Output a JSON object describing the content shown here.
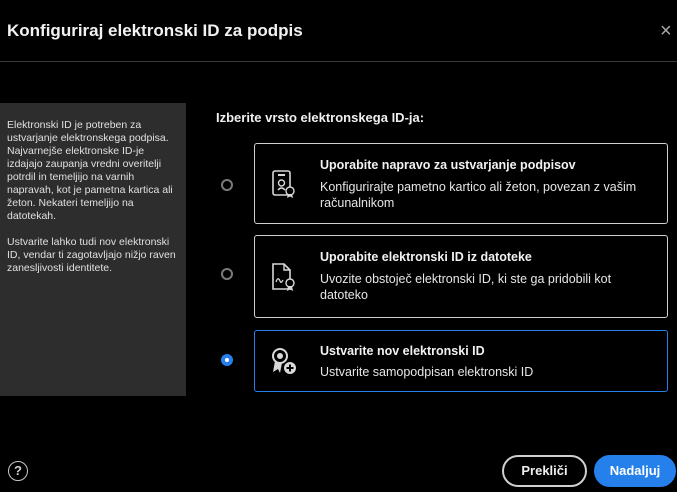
{
  "dialog": {
    "title": "Konfiguriraj elektronski ID za podpis",
    "close_glyph": "×"
  },
  "help_panel": {
    "paragraph_1": "Elektronski ID je potreben za ustvarjanje elektronskega podpisa. Najvarnejše elektronske ID-je izdajajo zaupanja vredni overitelji potrdil in temeljijo na varnih napravah, kot je pametna kartica ali žeton. Nekateri temeljijo na datotekah.",
    "paragraph_2": "Ustvarite lahko tudi nov elektronski ID, vendar ti zagotavljajo nižjo raven zanesljivosti identitete."
  },
  "section_label": "Izberite vrsto elektronskega ID-ja:",
  "options": [
    {
      "title": "Uporabite napravo za ustvarjanje podpisov",
      "description": "Konfigurirajte pametno kartico ali žeton, povezan z vašim računalnikom",
      "icon": "smartcard-device-icon",
      "selected": false
    },
    {
      "title": "Uporabite elektronski ID iz datoteke",
      "description": "Uvozite obstoječ elektronski ID, ki ste ga pridobili kot datoteko",
      "icon": "certificate-file-icon",
      "selected": false
    },
    {
      "title": "Ustvarite nov elektronski ID",
      "description": "Ustvarite samopodpisan elektronski ID",
      "icon": "new-certificate-icon",
      "selected": true
    }
  ],
  "footer": {
    "help_glyph": "?",
    "cancel_label": "Prekliči",
    "continue_label": "Nadaljuj"
  },
  "colors": {
    "accent": "#2680eb",
    "background": "#000000",
    "panel": "#2d2d2d"
  }
}
